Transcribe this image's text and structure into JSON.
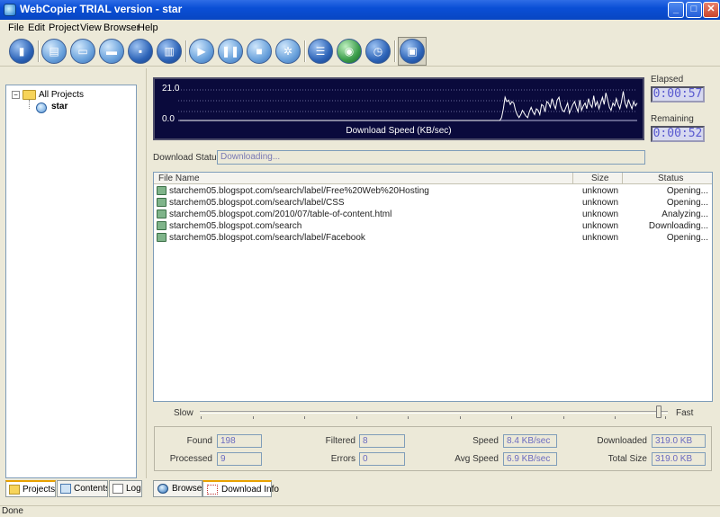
{
  "window": {
    "title": "WebCopier TRIAL version - star"
  },
  "menu": [
    "File",
    "Edit",
    "Project",
    "View",
    "Browser",
    "Help"
  ],
  "toolbar": {
    "buttons": [
      "new-project",
      "properties",
      "open",
      "folder",
      "save",
      "print",
      "start",
      "pause",
      "stop",
      "filter",
      "log",
      "export",
      "schedule",
      "offline-browser"
    ]
  },
  "projects_tree": {
    "root": "All Projects",
    "child": "star"
  },
  "left_tabs": [
    "Projects",
    "Contents",
    "Log"
  ],
  "speed_graph": {
    "y_max": "21.0",
    "y_min": "0.0",
    "caption": "Download Speed (KB/sec)",
    "samples": [
      0,
      0,
      0,
      0,
      0,
      0,
      0,
      0,
      0,
      0,
      0,
      0,
      0,
      0,
      0,
      0,
      0,
      0,
      0,
      0,
      0,
      0,
      0,
      0,
      0,
      0,
      0,
      0,
      0,
      0,
      0,
      0,
      0,
      0,
      0,
      0,
      0,
      0,
      0,
      0,
      0,
      0,
      0,
      0,
      0,
      0,
      0,
      0,
      0,
      0,
      0,
      0,
      0,
      0,
      0,
      0,
      0,
      0,
      0,
      0,
      0,
      0,
      0,
      0,
      0,
      0,
      0,
      0,
      0,
      0,
      0,
      0,
      0,
      0,
      0,
      0,
      0,
      0,
      0,
      0,
      0,
      0,
      0,
      0,
      0,
      0,
      0,
      0,
      0,
      0,
      0,
      0,
      0,
      0,
      0,
      0,
      0,
      0,
      0,
      0,
      0,
      0,
      0,
      0,
      0,
      0,
      0,
      0,
      0,
      0,
      0,
      0,
      0,
      0,
      0,
      0,
      0,
      0,
      0,
      0,
      0,
      0,
      0,
      0,
      0,
      0,
      0,
      0,
      0,
      0,
      0,
      0,
      0,
      0,
      0,
      0,
      0,
      0,
      0,
      0,
      0,
      0,
      0,
      0,
      0,
      0,
      0,
      0,
      0,
      0,
      0,
      0,
      0,
      0,
      0,
      0,
      0,
      0,
      0,
      0,
      0,
      0,
      0,
      0,
      0,
      0,
      0,
      0,
      0,
      0,
      0,
      0,
      0,
      0,
      0,
      0,
      0,
      0,
      0,
      0,
      0,
      0,
      0,
      0,
      0,
      2,
      8,
      16,
      13,
      14,
      11,
      13,
      12,
      7,
      4,
      2,
      4,
      7,
      5,
      3,
      2,
      6,
      9,
      6,
      4,
      8,
      7,
      4,
      11,
      10,
      6,
      13,
      12,
      9,
      15,
      11,
      8,
      14,
      16,
      10,
      7,
      6,
      9,
      12,
      5,
      8,
      11,
      13,
      9,
      6,
      14,
      7,
      10,
      12,
      8,
      15,
      11,
      9,
      17,
      10,
      13,
      8,
      12,
      16,
      11,
      19,
      14,
      9,
      7,
      12,
      10,
      15,
      11,
      8,
      13,
      20,
      12,
      9,
      14,
      11,
      8,
      13,
      10,
      12
    ]
  },
  "elapsed": {
    "label": "Elapsed",
    "value": "0:00:57"
  },
  "remaining": {
    "label": "Remaining",
    "value": "0:00:52"
  },
  "download_status": {
    "label": "Download Status",
    "value": "Downloading..."
  },
  "file_list": {
    "columns": [
      "File Name",
      "Size",
      "Status"
    ],
    "rows": [
      {
        "name": "starchem05.blogspot.com/search/label/Free%20Web%20Hosting",
        "size": "unknown",
        "status": "Opening..."
      },
      {
        "name": "starchem05.blogspot.com/search/label/CSS",
        "size": "unknown",
        "status": "Opening..."
      },
      {
        "name": "starchem05.blogspot.com/2010/07/table-of-content.html",
        "size": "unknown",
        "status": "Analyzing..."
      },
      {
        "name": "starchem05.blogspot.com/search",
        "size": "unknown",
        "status": "Downloading..."
      },
      {
        "name": "starchem05.blogspot.com/search/label/Facebook",
        "size": "unknown",
        "status": "Opening..."
      }
    ]
  },
  "speed_slider": {
    "slow_label": "Slow",
    "fast_label": "Fast",
    "level": 0.98
  },
  "stats": {
    "found_label": "Found",
    "found": "198",
    "processed_label": "Processed",
    "processed": "9",
    "filtered_label": "Filtered",
    "filtered": "8",
    "errors_label": "Errors",
    "errors": "0",
    "speed_label": "Speed",
    "speed": "8.4 KB/sec",
    "avg_speed_label": "Avg Speed",
    "avg_speed": "6.9 KB/sec",
    "downloaded_label": "Downloaded",
    "downloaded": "319.0 KB",
    "total_size_label": "Total Size",
    "total_size": "319.0 KB"
  },
  "right_tabs": [
    "Browser",
    "Download Info"
  ],
  "statusbar": {
    "text": "Done"
  }
}
